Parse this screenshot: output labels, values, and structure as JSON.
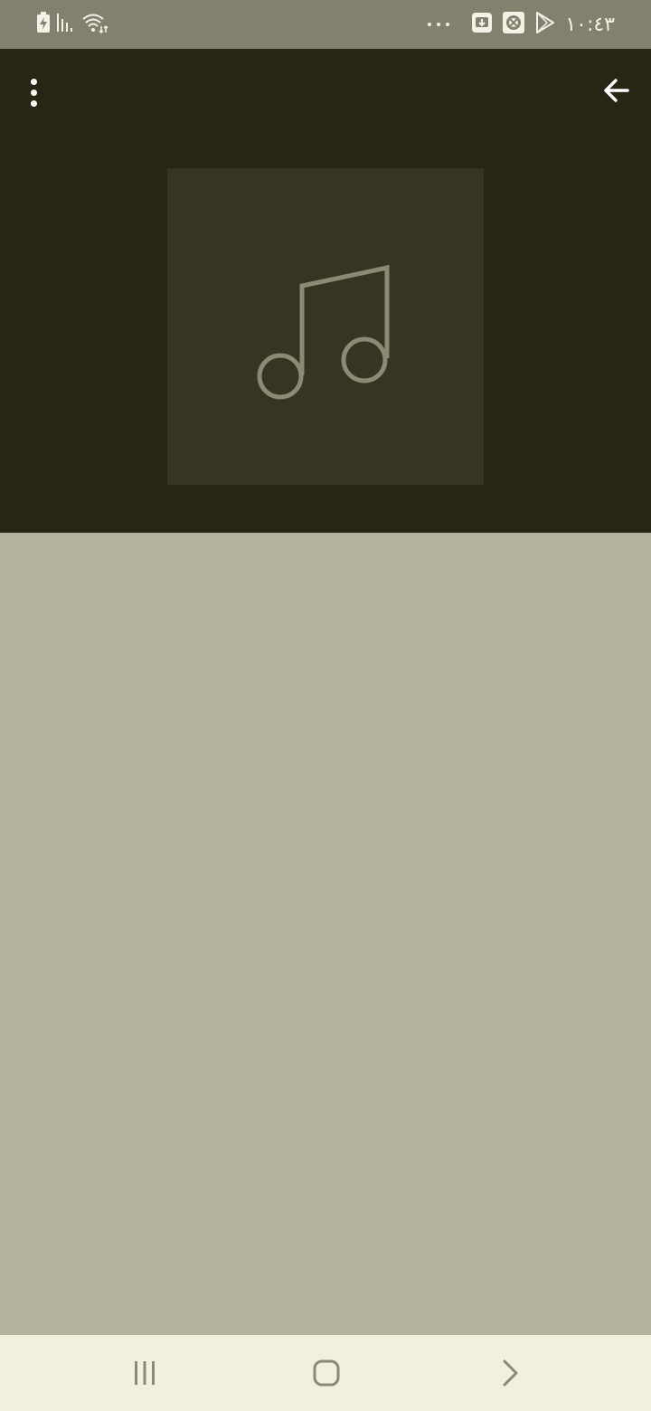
{
  "status_bar": {
    "time": "١٠:٤٣",
    "left_icons": [
      "battery-charging-icon",
      "signal-icon",
      "wifi-icon"
    ],
    "right_icons": [
      "more-notifications-icon",
      "download-notification-icon",
      "app-notification-icon",
      "play-store-icon"
    ]
  },
  "toolbar": {
    "menu_icon": "more-vert-icon",
    "back_icon": "arrow-back-icon"
  },
  "player": {
    "album_art_placeholder_icon": "music-note-icon"
  },
  "nav_bar": {
    "buttons": [
      "recent-apps",
      "home",
      "back"
    ]
  },
  "colors": {
    "status_bar": "#828170",
    "header": "#272513",
    "album_art_bg": "#363422",
    "content": "#b3b29c",
    "nav_bar": "#f2f0dc"
  }
}
